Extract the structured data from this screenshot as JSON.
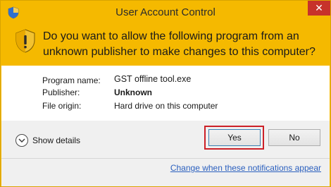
{
  "window": {
    "title": "User Account Control",
    "close_symbol": "✕"
  },
  "header": {
    "question": "Do you want to allow the following program from an unknown publisher to make changes to this computer?"
  },
  "details": {
    "program_name_label": "Program name:",
    "program_name_value": "GST offline tool.exe",
    "publisher_label": "Publisher:",
    "publisher_value": "Unknown",
    "file_origin_label": "File origin:",
    "file_origin_value": "Hard drive on this computer"
  },
  "footer": {
    "show_details_label": "Show details",
    "yes_label": "Yes",
    "no_label": "No",
    "notifications_link": "Change when these notifications appear"
  },
  "icons": {
    "title_icon": "shield-icon",
    "warning_icon": "warning-shield-icon",
    "details_icon": "chevron-down-icon"
  },
  "colors": {
    "banner": "#f5b900",
    "close_button": "#c7322b",
    "highlight_box": "#cc2027",
    "link": "#2a5fbe"
  }
}
